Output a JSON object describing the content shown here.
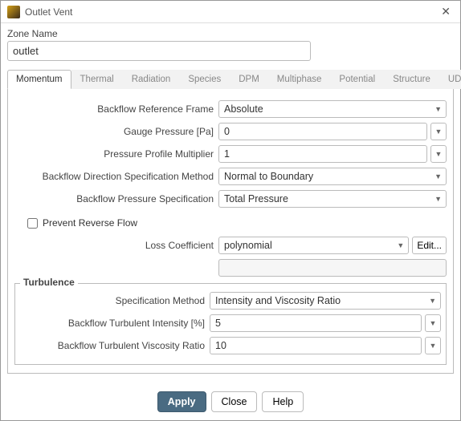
{
  "window": {
    "title": "Outlet Vent"
  },
  "zone": {
    "label": "Zone Name",
    "value": "outlet"
  },
  "tabs": [
    "Momentum",
    "Thermal",
    "Radiation",
    "Species",
    "DPM",
    "Multiphase",
    "Potential",
    "Structure",
    "UDS"
  ],
  "momentum": {
    "backflow_ref_frame": {
      "label": "Backflow Reference Frame",
      "value": "Absolute"
    },
    "gauge_pressure": {
      "label": "Gauge Pressure [Pa]",
      "value": "0"
    },
    "pressure_profile_mult": {
      "label": "Pressure Profile Multiplier",
      "value": "1"
    },
    "backflow_dir_method": {
      "label": "Backflow Direction Specification Method",
      "value": "Normal to Boundary"
    },
    "backflow_press_spec": {
      "label": "Backflow Pressure Specification",
      "value": "Total Pressure"
    },
    "prevent_reverse": {
      "label": "Prevent Reverse Flow",
      "checked": false
    },
    "loss_coeff": {
      "label": "Loss Coefficient",
      "value": "polynomial",
      "edit": "Edit..."
    }
  },
  "turbulence": {
    "legend": "Turbulence",
    "spec_method": {
      "label": "Specification Method",
      "value": "Intensity and Viscosity Ratio"
    },
    "intensity": {
      "label": "Backflow Turbulent Intensity [%]",
      "value": "5"
    },
    "visc_ratio": {
      "label": "Backflow Turbulent Viscosity Ratio",
      "value": "10"
    }
  },
  "footer": {
    "apply": "Apply",
    "close": "Close",
    "help": "Help"
  }
}
